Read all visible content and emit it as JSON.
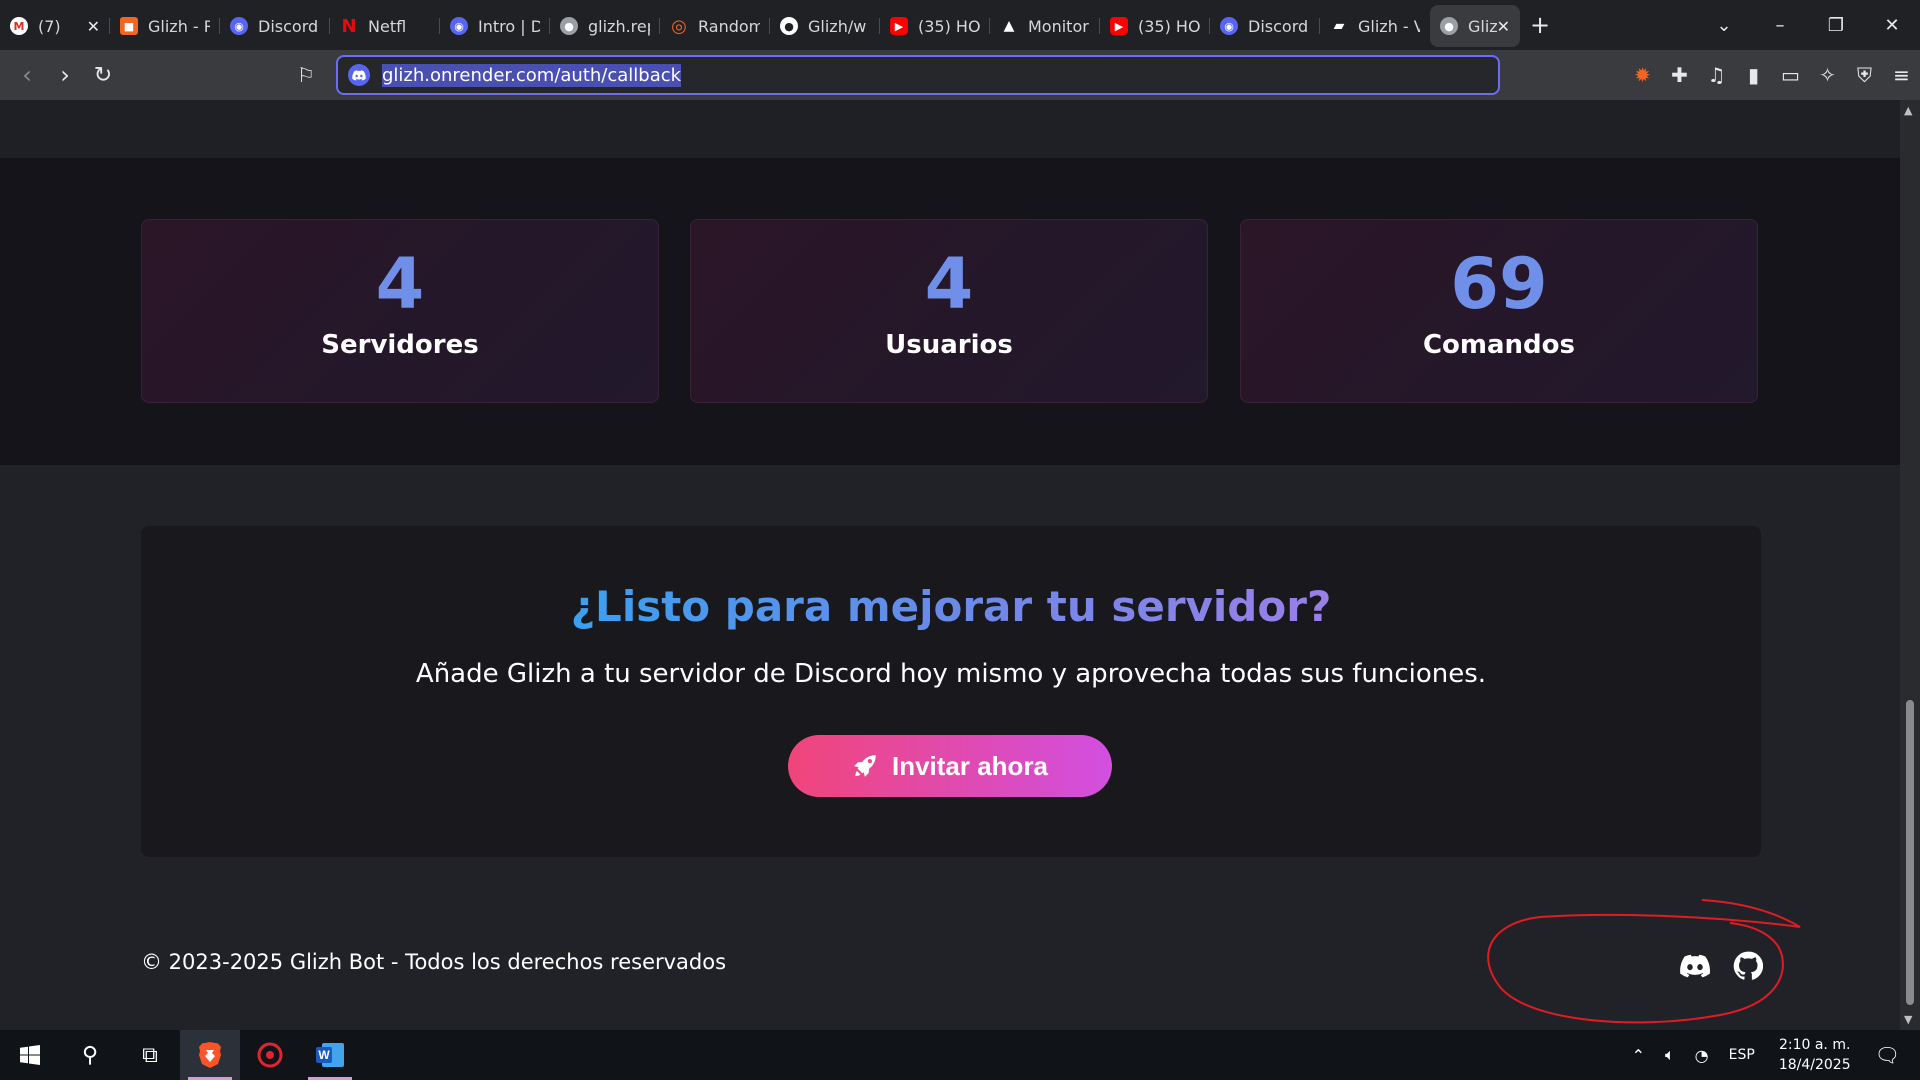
{
  "tabs": [
    {
      "title": "(7)",
      "favicon": "gmail-icon",
      "color": "#d93025"
    },
    {
      "title": "Glizh - R",
      "favicon": "render-icon",
      "color": "#f26522"
    },
    {
      "title": "Discord",
      "favicon": "discord-icon",
      "color": "#5865f2"
    },
    {
      "title": "Netfl",
      "favicon": "netflix-icon",
      "color": "#e50914"
    },
    {
      "title": "Intro | D",
      "favicon": "discord-icon",
      "color": "#5865f2"
    },
    {
      "title": "glizh.rep",
      "favicon": "globe-icon",
      "color": "#9aa0a6"
    },
    {
      "title": "Random",
      "favicon": "fingerprint-icon",
      "color": "#f26522"
    },
    {
      "title": "Glizh/w",
      "favicon": "github-icon",
      "color": "#ffffff"
    },
    {
      "title": "(35) HO",
      "favicon": "youtube-icon",
      "color": "#ff0000"
    },
    {
      "title": "Monitor",
      "favicon": "monitor-icon",
      "color": "#ffffff"
    },
    {
      "title": "(35) HO",
      "favicon": "youtube-icon",
      "color": "#ff0000"
    },
    {
      "title": "Discord",
      "favicon": "discord-icon",
      "color": "#5865f2"
    },
    {
      "title": "Glizh - V",
      "favicon": "vercel-icon",
      "color": "#ffffff"
    },
    {
      "title": "Glizh",
      "favicon": "globe-icon",
      "color": "#9aa0a6",
      "active": true
    }
  ],
  "address_bar": {
    "url": "glizh.onrender.com/auth/callback"
  },
  "stats": [
    {
      "value": "4",
      "label": "Servidores"
    },
    {
      "value": "4",
      "label": "Usuarios"
    },
    {
      "value": "69",
      "label": "Comandos"
    }
  ],
  "cta": {
    "title": "¿Listo para mejorar tu servidor?",
    "subtitle": "Añade Glizh a tu servidor de Discord hoy mismo y aprovecha todas sus funciones.",
    "button_label": "Invitar ahora"
  },
  "footer": {
    "copyright": "© 2023-2025 Glizh Bot - Todos los derechos reservados",
    "social": [
      "discord-icon",
      "github-icon"
    ]
  },
  "annotation_color": "#e01b24",
  "taskbar": {
    "apps": [
      "windows-start-icon",
      "search-icon",
      "task-view-icon",
      "brave-icon",
      "app-red-icon",
      "word-icon"
    ],
    "language": "ESP",
    "time": "2:10 a. m.",
    "date": "18/4/2025"
  }
}
